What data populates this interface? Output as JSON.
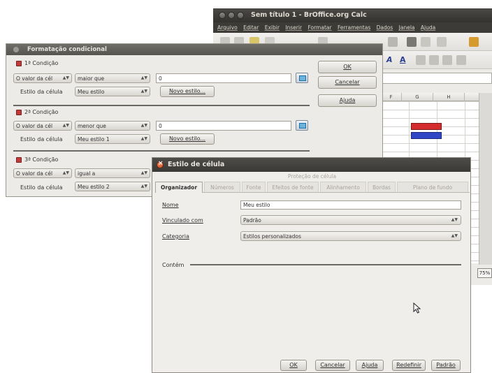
{
  "calc": {
    "title": "Sem título 1 - BrOffice.org Calc",
    "menu": [
      "Arquivo",
      "Editar",
      "Exibir",
      "Inserir",
      "Formatar",
      "Ferramentas",
      "Dados",
      "Janela",
      "Ajuda"
    ],
    "columns": [
      "F",
      "G",
      "H"
    ],
    "zoom": "75%"
  },
  "conditional_dialog": {
    "title": "Formatação condicional",
    "conditions": [
      {
        "label": "1ª Condição",
        "source": "O valor da cél",
        "operator": "maior que",
        "value": "0",
        "style_label": "Estilo da célula",
        "style": "Meu estilo",
        "new_style": "Novo estilo..."
      },
      {
        "label": "2ª Condição",
        "source": "O valor da cél",
        "operator": "menor que",
        "value": "0",
        "style_label": "Estilo da célula",
        "style": "Meu estilo 1",
        "new_style": "Novo estilo..."
      },
      {
        "label": "3ª Condição",
        "source": "O valor da cél",
        "operator": "igual a",
        "value": "",
        "style_label": "Estilo da célula",
        "style": "Meu estilo 2",
        "new_style": ""
      }
    ],
    "buttons": {
      "ok": "OK",
      "cancel": "Cancelar",
      "help": "Ajuda"
    }
  },
  "cell_style_dialog": {
    "title": "Estilo de célula",
    "tabs_top": "Proteção de célula",
    "tabs": [
      "Organizador",
      "Números",
      "Fonte",
      "Efeitos de fonte",
      "Alinhamento",
      "Bordas",
      "Plano de fundo"
    ],
    "name_label": "Nome",
    "name_value": "Meu estilo",
    "linked_label": "Vinculado com",
    "linked_value": "Padrão",
    "category_label": "Categoria",
    "category_value": "Estilos personalizados",
    "contains_label": "Contém",
    "buttons": {
      "ok": "OK",
      "cancel": "Cancelar",
      "help": "Ajuda",
      "reset": "Redefinir",
      "default": "Padrão"
    }
  },
  "colors": {
    "cond_red": "#d42c2c",
    "cond_blue": "#2f47c6",
    "title_dark": "#3a3935"
  }
}
